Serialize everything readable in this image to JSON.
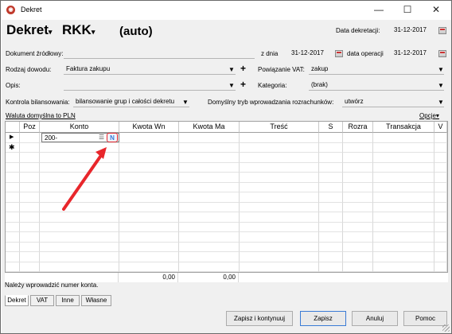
{
  "window": {
    "title": "Dekret",
    "minimize": "—",
    "maximize": "☐",
    "close": "✕"
  },
  "header": {
    "doc_type": "Dekret",
    "doc_subtype": "RKK",
    "number": "(auto)",
    "date_label": "Data dekretacji:",
    "date_value": "31-12-2017"
  },
  "form": {
    "source_label": "Dokument źródłowy:",
    "source_value": "",
    "zdnia_label": "z dnia",
    "zdnia_value": "31-12-2017",
    "operation_label": "data operacji",
    "operation_value": "31-12-2017",
    "rodzaj_label": "Rodzaj dowodu:",
    "rodzaj_value": "Faktura zakupu",
    "vat_label": "Powiązanie VAT:",
    "vat_value": "zakup",
    "opis_label": "Opis:",
    "opis_value": "",
    "kategoria_label": "Kategoria:",
    "kategoria_value": "(brak)",
    "kontrola_label": "Kontrola bilansowania:",
    "kontrola_value": "bilansowanie grup i całości dekretu",
    "tryb_label": "Domyślny tryb wprowadzania rozrachunków:",
    "tryb_value": "utwórz",
    "currency_link": "Waluta domyślna to PLN",
    "options_link": "Opcje"
  },
  "grid": {
    "columns": [
      "Poz",
      "Konto",
      "Kwota Wn",
      "Kwota Ma",
      "Treść",
      "S",
      "Rozra",
      "Transakcja",
      "V"
    ],
    "rows": [
      {
        "marker": "▶",
        "poz": "",
        "konto": "200-",
        "n_label": "N"
      },
      {
        "marker": "✱",
        "poz": "",
        "konto": "",
        "n_label": ""
      }
    ],
    "totals": {
      "wn": "0,00",
      "ma": "0,00"
    }
  },
  "status_text": "Należy wprowadzić numer konta.",
  "tabs": [
    "Dekret",
    "VAT",
    "Inne",
    "Własne"
  ],
  "buttons": {
    "save_continue": "Zapisz i kontynuuj",
    "save": "Zapisz",
    "cancel": "Anuluj",
    "help": "Pomoc"
  },
  "colors": {
    "annotation": "#e8262b",
    "highlight_border": "#3a7bd5"
  }
}
